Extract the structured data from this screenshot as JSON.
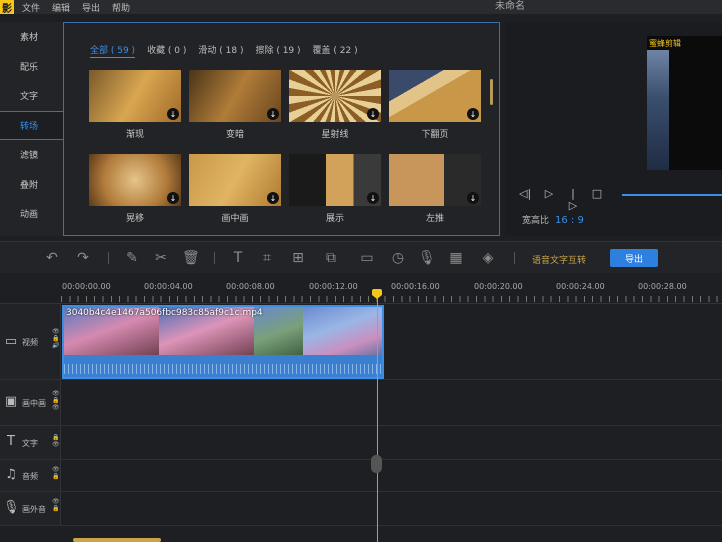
{
  "app": {
    "logo_char": "影",
    "title": "未命名"
  },
  "menu": [
    "文件",
    "编辑",
    "导出",
    "帮助"
  ],
  "sidebar": [
    {
      "label": "素材",
      "active": false
    },
    {
      "label": "配乐",
      "active": false
    },
    {
      "label": "文字",
      "active": false
    },
    {
      "label": "转场",
      "active": true
    },
    {
      "label": "滤镜",
      "active": false
    },
    {
      "label": "叠附",
      "active": false
    },
    {
      "label": "动画",
      "active": false
    }
  ],
  "tabs": [
    "全部 ( 59 )",
    "收藏 ( 0 )",
    "滑动 ( 18 )",
    "擦除 ( 19 )",
    "覆盖 ( 22 )"
  ],
  "transitions": [
    {
      "label": "渐现",
      "color": "#b98a3c"
    },
    {
      "label": "变暗",
      "color": "#9b6a2c"
    },
    {
      "label": "星射线",
      "color": "#d7b06a"
    },
    {
      "label": "下翻页",
      "color": "#c99748"
    },
    {
      "label": "晃移",
      "color": "#c99a52"
    },
    {
      "label": "画中画",
      "color": "#d4a24a"
    },
    {
      "label": "展示",
      "color": "#5a5a5a"
    },
    {
      "label": "左推",
      "color": "#c89554"
    }
  ],
  "preview": {
    "watermark": "蜜蜂剪辑",
    "ratio_label": "宽高比",
    "ratio_value": "16 : 9",
    "progress_percent": 100
  },
  "toolbar": {
    "speech_label": "语音文字互转",
    "export_label": "导出"
  },
  "ruler": [
    "00:00:00.00",
    "00:00:04.00",
    "00:00:08.00",
    "00:00:12.00",
    "00:00:16.00",
    "00:00:20.00",
    "00:00:24.00",
    "00:00:28.00"
  ],
  "tracks": [
    {
      "label": "视频",
      "icon": "video-icon"
    },
    {
      "label": "画中画",
      "icon": "pip-icon"
    },
    {
      "label": "文字",
      "icon": "text-icon"
    },
    {
      "label": "音频",
      "icon": "music-icon"
    },
    {
      "label": "画外音",
      "icon": "mic-icon"
    }
  ],
  "clip": {
    "filename": "3040b4c4e1467a506fbc983c85af9c1c.mp4"
  }
}
